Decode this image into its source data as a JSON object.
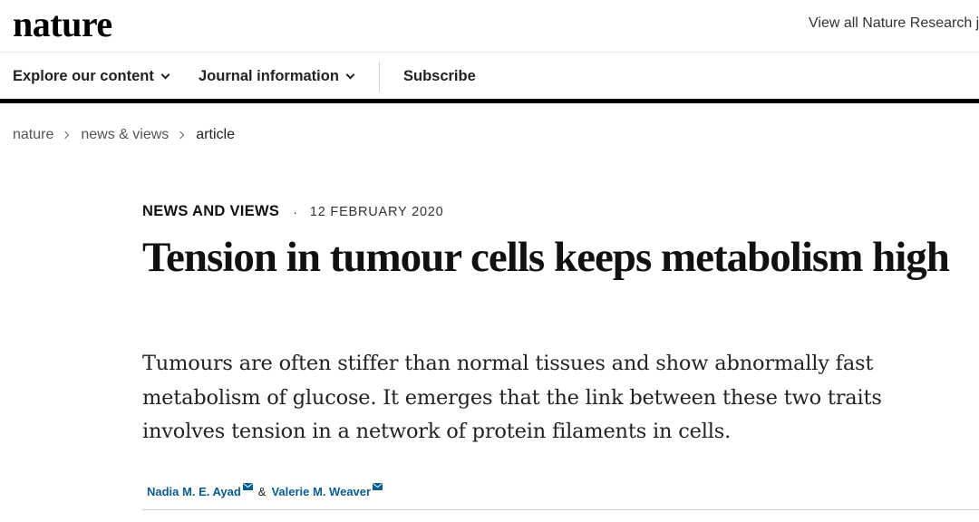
{
  "header": {
    "logo_text": "nature",
    "research_link": "View all Nature Research jo"
  },
  "nav": {
    "items": [
      {
        "label": "Explore our content",
        "icon": "chevron-down-icon"
      },
      {
        "label": "Journal information",
        "icon": "chevron-down-icon"
      },
      {
        "label": "Subscribe"
      }
    ]
  },
  "breadcrumb": {
    "items": [
      "nature",
      "news & views",
      "article"
    ],
    "separator_icon": "chevron-right-icon"
  },
  "article": {
    "type": "NEWS AND VIEWS",
    "separator": "·",
    "date": "12 FEBRUARY 2020",
    "title": "Tension in tumour cells keeps metabolism high",
    "standfirst": "Tumours are often stiffer than normal tissues and show abnormally fast metabolism of glucose. It emerges that the link between these two traits involves tension in a network of protein filaments in cells.",
    "authors": [
      {
        "name": "Nadia M. E. Ayad",
        "icon": "mail-icon"
      },
      {
        "name": "Valerie M. Weaver",
        "icon": "mail-icon"
      }
    ],
    "author_joiner": "&"
  },
  "colors": {
    "author_link": "#0a5b8e",
    "text": "#222222",
    "rule": "#000000"
  }
}
